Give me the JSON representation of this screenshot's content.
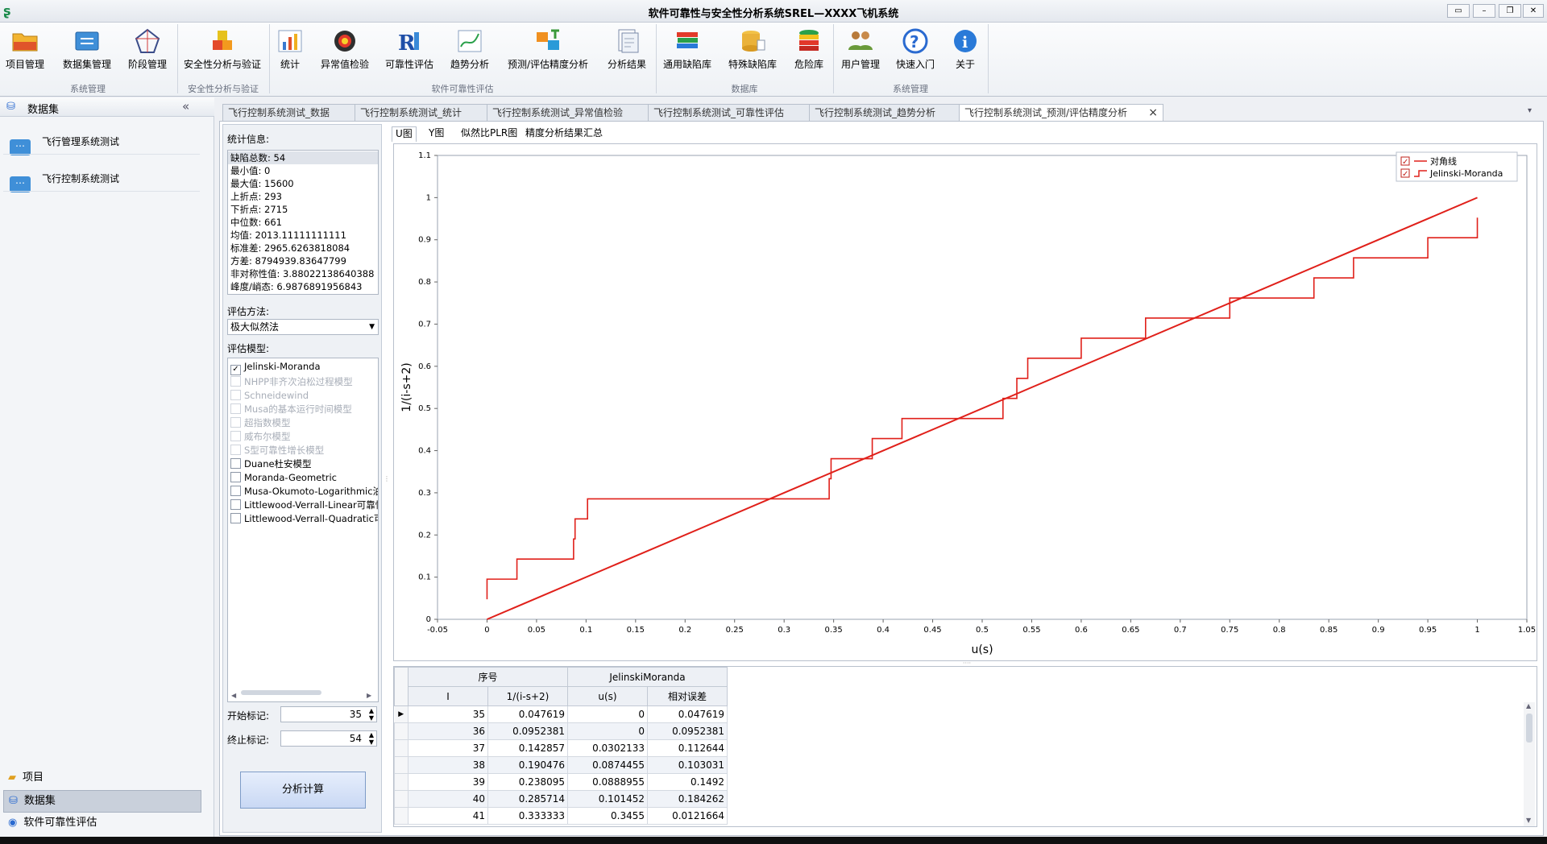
{
  "window": {
    "title": "软件可靠性与安全性分析系统SREL—XXXX飞机系统"
  },
  "ribbon": {
    "buttons": [
      {
        "label": "项目管理",
        "icon": "folder-icon"
      },
      {
        "label": "数据集管理",
        "icon": "dataset-icon"
      },
      {
        "label": "阶段管理",
        "icon": "stage-icon"
      },
      {
        "label": "安全性分析与验证",
        "icon": "safety-icon"
      },
      {
        "label": "统计",
        "icon": "bar-chart-icon"
      },
      {
        "label": "异常值检验",
        "icon": "outlier-icon"
      },
      {
        "label": "可靠性评估",
        "icon": "reliability-icon"
      },
      {
        "label": "趋势分析",
        "icon": "trend-icon"
      },
      {
        "label": "预测/评估精度分析",
        "icon": "precision-icon"
      },
      {
        "label": "分析结果",
        "icon": "result-icon"
      },
      {
        "label": "通用缺陷库",
        "icon": "books-icon"
      },
      {
        "label": "特殊缺陷库",
        "icon": "database-icon"
      },
      {
        "label": "危险库",
        "icon": "danger-db-icon"
      },
      {
        "label": "用户管理",
        "icon": "users-icon"
      },
      {
        "label": "快速入门",
        "icon": "help-icon"
      },
      {
        "label": "关于",
        "icon": "info-icon"
      }
    ],
    "groups": [
      "系统管理",
      "安全性分析与验证",
      "软件可靠性评估",
      "数据库",
      "系统管理"
    ]
  },
  "nav": {
    "header": "数据集",
    "collapse": "«",
    "items": [
      "飞行管理系统测试",
      "飞行控制系统测试"
    ],
    "bottom": [
      "项目",
      "数据集",
      "软件可靠性评估"
    ]
  },
  "tabs": [
    "飞行控制系统测试_数据",
    "飞行控制系统测试_统计",
    "飞行控制系统测试_异常值检验",
    "飞行控制系统测试_可靠性评估",
    "飞行控制系统测试_趋势分析",
    "飞行控制系统测试_预测/评估精度分析"
  ],
  "tab_close": "×",
  "stats": {
    "label": "统计信息:",
    "lines": [
      "缺陷总数: 54",
      "最小值:  0",
      "最大值:  15600",
      "上折点:  293",
      "下折点:  2715",
      "中位数:  661",
      "均值:  2013.11111111111",
      "标准差:  2965.6263818084",
      "方差:  8794939.83647799",
      "非对称性值: 3.88022138640388",
      "峰度/峭态: 6.9876891956843"
    ]
  },
  "method": {
    "label": "评估方法:",
    "value": "极大似然法"
  },
  "models": {
    "label": "评估模型:",
    "items": [
      {
        "name": "Jelinski-Moranda",
        "checked": true,
        "enabled": true
      },
      {
        "name": "NHPP非齐次泊松过程模型",
        "checked": false,
        "enabled": false
      },
      {
        "name": "Schneidewind",
        "checked": false,
        "enabled": false
      },
      {
        "name": "Musa的基本运行时间模型",
        "checked": false,
        "enabled": false
      },
      {
        "name": "超指数模型",
        "checked": false,
        "enabled": false
      },
      {
        "name": "威布尔模型",
        "checked": false,
        "enabled": false
      },
      {
        "name": "S型可靠性增长模型",
        "checked": false,
        "enabled": false
      },
      {
        "name": "Duane杜安模型",
        "checked": false,
        "enabled": true
      },
      {
        "name": "Moranda-Geometric",
        "checked": false,
        "enabled": true
      },
      {
        "name": "Musa-Okumoto-Logarithmic泊松",
        "checked": false,
        "enabled": true
      },
      {
        "name": "Littlewood-Verrall-Linear可靠性",
        "checked": false,
        "enabled": true
      },
      {
        "name": "Littlewood-Verrall-Quadratic可靠",
        "checked": false,
        "enabled": true
      }
    ]
  },
  "range": {
    "start_label": "开始标记:",
    "start": "35",
    "end_label": "终止标记:",
    "end": "54"
  },
  "compute_button": "分析计算",
  "subtabs": [
    "U图",
    "Y图",
    "似然比PLR图",
    "精度分析结果汇总"
  ],
  "chart_data": {
    "type": "line",
    "xlabel": "u(s)",
    "ylabel": "1/(i-s+2)",
    "xlim": [
      -0.05,
      1.05
    ],
    "ylim": [
      0,
      1.1
    ],
    "xticks": [
      "-0.05",
      "0",
      "0.05",
      "0.1",
      "0.15",
      "0.2",
      "0.25",
      "0.3",
      "0.35",
      "0.4",
      "0.45",
      "0.5",
      "0.55",
      "0.6",
      "0.65",
      "0.7",
      "0.75",
      "0.8",
      "0.85",
      "0.9",
      "0.95",
      "1",
      "1.05"
    ],
    "yticks": [
      "0",
      "0.1",
      "0.2",
      "0.3",
      "0.4",
      "0.5",
      "0.6",
      "0.7",
      "0.8",
      "0.9",
      "1",
      "1.1"
    ],
    "grid": false,
    "legend_position": "top-right",
    "series": [
      {
        "name": "对角线",
        "color": "#e0201a",
        "style": "line",
        "x": [
          0,
          1
        ],
        "y": [
          0,
          1
        ]
      },
      {
        "name": "Jelinski-Moranda",
        "color": "#e0201a",
        "style": "step",
        "u": [
          0,
          0,
          0.0302,
          0.0874,
          0.0889,
          0.1015,
          0.3455,
          0.3474,
          0.389,
          0.419,
          0.521,
          0.535,
          0.546,
          0.6,
          0.665,
          0.75,
          0.835,
          0.875,
          0.95,
          1.0
        ],
        "y": [
          0.047619,
          0.0952381,
          0.142857,
          0.190476,
          0.238095,
          0.285714,
          0.333333,
          0.380952,
          0.428571,
          0.47619,
          0.52381,
          0.571429,
          0.619048,
          0.666667,
          0.714286,
          0.761905,
          0.809524,
          0.857143,
          0.904762,
          0.952381
        ]
      }
    ]
  },
  "table": {
    "group_headers": [
      "序号",
      "JelinskiMoranda"
    ],
    "headers": [
      "I",
      "1/(i-s+2)",
      "u(s)",
      "相对误差"
    ],
    "rows": [
      [
        "35",
        "0.047619",
        "0",
        "0.047619"
      ],
      [
        "36",
        "0.0952381",
        "0",
        "0.0952381"
      ],
      [
        "37",
        "0.142857",
        "0.0302133",
        "0.112644"
      ],
      [
        "38",
        "0.190476",
        "0.0874455",
        "0.103031"
      ],
      [
        "39",
        "0.238095",
        "0.0888955",
        "0.1492"
      ],
      [
        "40",
        "0.285714",
        "0.101452",
        "0.184262"
      ],
      [
        "41",
        "0.333333",
        "0.3455",
        "0.0121664"
      ]
    ]
  }
}
